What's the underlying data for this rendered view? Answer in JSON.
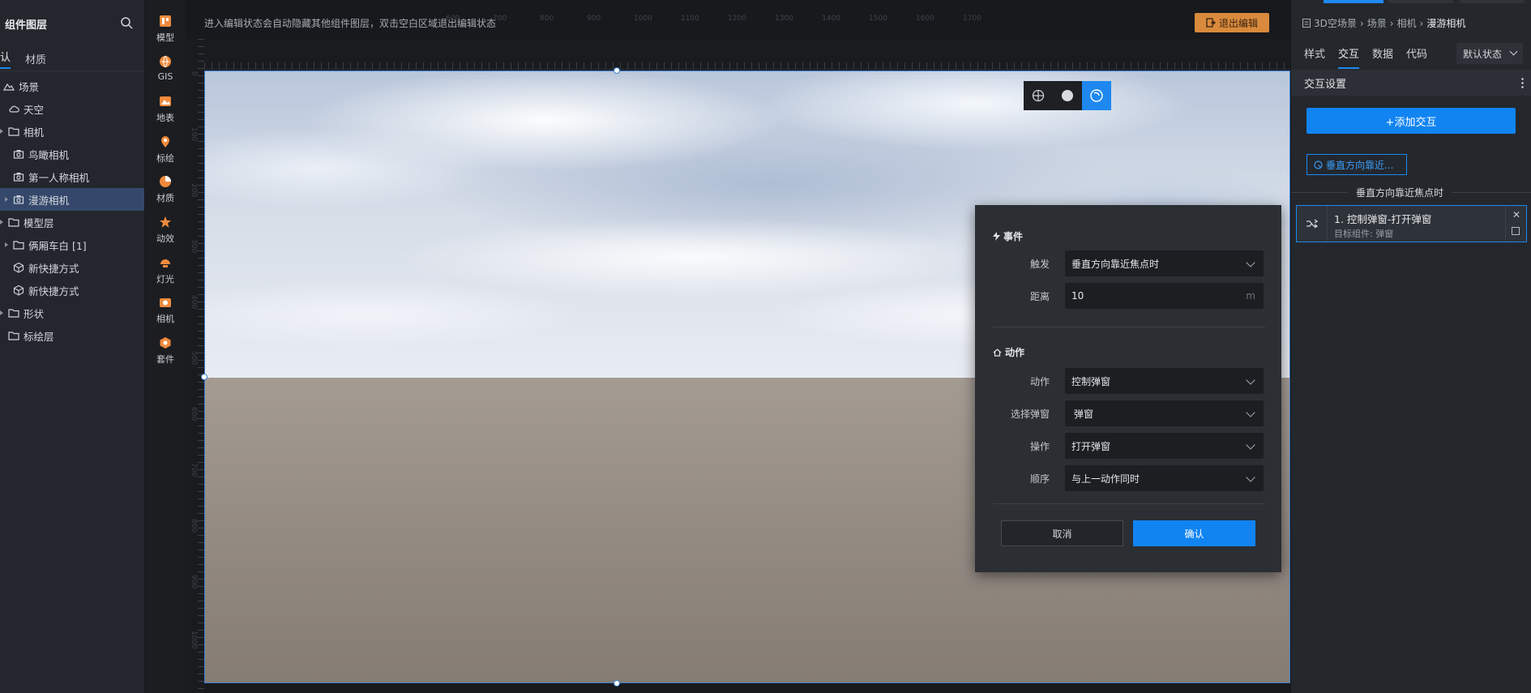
{
  "left_panel": {
    "title": "组件图层",
    "tabs": [
      "认",
      "材质"
    ],
    "tree": [
      {
        "label": "场景",
        "icon": "scene-icon",
        "indent": 0
      },
      {
        "label": "天空",
        "icon": "sky-icon",
        "indent": 1
      },
      {
        "label": "相机",
        "icon": "folder-icon",
        "indent": 1
      },
      {
        "label": "鸟瞰相机",
        "icon": "camera-icon",
        "indent": 2
      },
      {
        "label": "第一人称相机",
        "icon": "camera-icon",
        "indent": 2
      },
      {
        "label": "漫游相机",
        "icon": "camera-icon",
        "indent": 2,
        "selected": true
      },
      {
        "label": "模型层",
        "icon": "folder-icon",
        "indent": 1
      },
      {
        "label": "俩厢车白 [1]",
        "icon": "folder-icon",
        "indent": 2
      },
      {
        "label": "新快捷方式",
        "icon": "cube-icon",
        "indent": 2
      },
      {
        "label": "新快捷方式",
        "icon": "cube-icon",
        "indent": 2
      },
      {
        "label": "形状",
        "icon": "folder-icon",
        "indent": 1
      },
      {
        "label": "标绘层",
        "icon": "folder-icon",
        "indent": 1
      }
    ]
  },
  "toolbar": {
    "items": [
      {
        "label": "模型",
        "icon": "model-icon"
      },
      {
        "label": "GIS",
        "icon": "gis-icon"
      },
      {
        "label": "地表",
        "icon": "terrain-icon"
      },
      {
        "label": "标绘",
        "icon": "marker-icon"
      },
      {
        "label": "材质",
        "icon": "material-icon"
      },
      {
        "label": "动效",
        "icon": "effect-icon"
      },
      {
        "label": "灯光",
        "icon": "light-icon"
      },
      {
        "label": "相机",
        "icon": "camera-icon"
      },
      {
        "label": "套件",
        "icon": "kit-icon"
      }
    ]
  },
  "canvas": {
    "hint": "进入编辑状态会自动隐藏其他组件图层，双击空白区域退出编辑状态",
    "exit_label": "退出编辑",
    "ruler_top": [
      "600",
      "700",
      "800",
      "900",
      "1000",
      "1100",
      "1200",
      "1300",
      "1400",
      "1500",
      "1600",
      "1700"
    ],
    "ruler_left": [
      "0",
      "100",
      "200",
      "300",
      "400",
      "500",
      "600",
      "700",
      "800",
      "900",
      "1000"
    ]
  },
  "dialog": {
    "event_title": "事件",
    "trigger_label": "触发",
    "trigger_value": "垂直方向靠近焦点时",
    "distance_label": "距离",
    "distance_value": "10",
    "distance_unit": "m",
    "action_title": "动作",
    "action_label": "动作",
    "action_value": "控制弹窗",
    "popup_label": "选择弹窗",
    "popup_value": "弹窗",
    "operation_label": "操作",
    "operation_value": "打开弹窗",
    "order_label": "顺序",
    "order_value": "与上一动作同时",
    "cancel_label": "取消",
    "confirm_label": "确认"
  },
  "right_panel": {
    "breadcrumb": [
      "3D空场景",
      "场景",
      "相机",
      "漫游相机"
    ],
    "tabs": [
      "样式",
      "交互",
      "数据",
      "代码"
    ],
    "active_tab": "交互",
    "state_select": "默认状态",
    "section_title": "交互设置",
    "add_label": "+添加交互",
    "trigger_tag": "垂直方向靠近...",
    "group_title": "垂直方向靠近焦点时",
    "action_card_title": "1. 控制弹窗-打开弹窗",
    "action_card_sub": "目标组件: 弹窗"
  },
  "colors": {
    "accent": "#1184f2",
    "exit_button": "#d98a3c",
    "selected_row": "#35486b"
  }
}
